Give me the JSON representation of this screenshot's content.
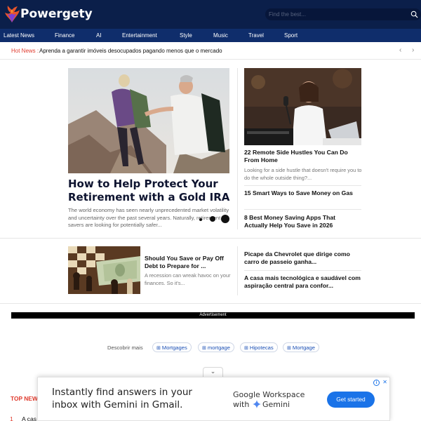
{
  "brand": {
    "name": "Powergety"
  },
  "search": {
    "placeholder": "Find the best..."
  },
  "nav": [
    "Latest News",
    "Finance",
    "AI",
    "Entertainment",
    "Style",
    "Music",
    "Travel",
    "Sport"
  ],
  "hot_news": {
    "label": "Hot News :",
    "text": "Aprenda a garantir imóveis desocupados pagando menos que o mercado",
    "prev": "‹",
    "next": "›"
  },
  "featured": {
    "title": "How to Help Protect Your Retirement with a Gold IRA",
    "excerpt": "The world economy has seen nearly unprecedented market volatility and uncertainty over the past several years. Naturally, retirement savers are looking for potentially safer..."
  },
  "side": {
    "top_title": "22 Remote Side Hustles You Can Do From Home",
    "top_excerpt": "Looking for a side hustle that doesn't require you to do the whole outside thing?...",
    "item2": "15 Smart Ways to Save Money on Gas",
    "item3": "8 Best Money Saving Apps That Actually Help You Save in 2026"
  },
  "row2": {
    "title": "Should You Save or Pay Off Debt to Prepare for ...",
    "excerpt": "A recession can wreak havoc on your finances. So it's...",
    "right1": "Picape da Chevrolet que dirige como carro de passeio ganha...",
    "right2": "A casa mais tecnológica e saudável com aspiração central para confor..."
  },
  "advertisement_label": "Advertisement",
  "discover": {
    "label": "Descobrir mais",
    "chips": [
      "Mortgages",
      "mortgage",
      "Hipotecas",
      "Mortgage"
    ]
  },
  "collapse_icon": "⌄",
  "top_news": {
    "label": "TOP NEW",
    "first_num": "1",
    "first_text": "A cas"
  },
  "banner_ad": {
    "headline": "Instantly find answers in your inbox with Gemini in Gmail.",
    "brand_line1": "Google Workspace",
    "brand_with": "with",
    "brand_gemini": "Gemini",
    "cta": "Get started",
    "adchoices": "i",
    "close": "✕",
    "accent": "#1a73e8"
  },
  "colors": {
    "header_bg": "#0b1f4a",
    "nav_bg": "#0f2d6b",
    "hot_label": "#e03b2e"
  }
}
